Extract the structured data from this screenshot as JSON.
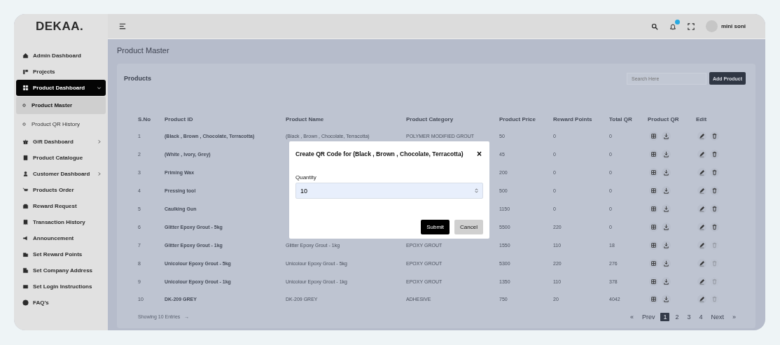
{
  "brand": "DEKAA.",
  "user": {
    "name": "mini soni"
  },
  "sidebar": {
    "items": [
      {
        "label": "Admin Dashboard",
        "kind": "item",
        "selected": false
      },
      {
        "label": "Projects",
        "kind": "item",
        "selected": false
      },
      {
        "label": "Product Dashboard",
        "kind": "group",
        "selected": true,
        "expanded": true,
        "children": [
          {
            "label": "Product Master",
            "selected": true
          },
          {
            "label": "Product QR History",
            "selected": false
          }
        ]
      },
      {
        "label": "Gift Dashboard",
        "kind": "group",
        "selected": false,
        "expanded": false
      },
      {
        "label": "Product Catalogue",
        "kind": "item",
        "selected": false
      },
      {
        "label": "Customer Dashboard",
        "kind": "group",
        "selected": false,
        "expanded": false
      },
      {
        "label": "Products Order",
        "kind": "item",
        "selected": false
      },
      {
        "label": "Reward Request",
        "kind": "item",
        "selected": false
      },
      {
        "label": "Transaction History",
        "kind": "item",
        "selected": false
      },
      {
        "label": "Announcement",
        "kind": "item",
        "selected": false
      },
      {
        "label": "Set Reward Points",
        "kind": "item",
        "selected": false
      },
      {
        "label": "Set Company Address",
        "kind": "item",
        "selected": false
      },
      {
        "label": "Set Login Instructions",
        "kind": "item",
        "selected": false
      },
      {
        "label": "FAQ's",
        "kind": "item",
        "selected": false
      }
    ]
  },
  "page_title": "Product Master",
  "card": {
    "title": "Products",
    "search": {
      "placeholder": "Search Here"
    },
    "add_button": "Add Product"
  },
  "table": {
    "columns": [
      "S.No",
      "Product ID",
      "Product Name",
      "Product Category",
      "Product Price",
      "Reward Points",
      "Total QR",
      "Product QR",
      "Edit"
    ],
    "rows": [
      {
        "sno": "1",
        "id": "(Black , Brown , Chocolate, Terracotta)",
        "name": "(Black , Brown , Chocolate, Terracotta)",
        "category": "POLYMER MODIFIED GROUT",
        "price": "50",
        "points": "0",
        "total": "0",
        "delete_disabled": false
      },
      {
        "sno": "2",
        "id": "(White , Ivory, Grey)",
        "name": null,
        "category": null,
        "price": "45",
        "points": "0",
        "total": "0",
        "delete_disabled": false
      },
      {
        "sno": "3",
        "id": "Priming Wax",
        "name": null,
        "category": null,
        "price": "200",
        "points": "0",
        "total": "0",
        "delete_disabled": false
      },
      {
        "sno": "4",
        "id": "Pressing tool",
        "name": null,
        "category": null,
        "price": "500",
        "points": "0",
        "total": "0",
        "delete_disabled": false
      },
      {
        "sno": "5",
        "id": "Caulking Gun",
        "name": null,
        "category": null,
        "price": "1150",
        "points": "0",
        "total": "0",
        "delete_disabled": false
      },
      {
        "sno": "6",
        "id": "Glitter Epoxy Grout - 5kg",
        "name": null,
        "category": null,
        "price": "5500",
        "points": "220",
        "total": "0",
        "delete_disabled": false
      },
      {
        "sno": "7",
        "id": "Glitter Epoxy Grout - 1kg",
        "name": "Glitter Epoxy Grout - 1kg",
        "category": "EPOXY GROUT",
        "price": "1550",
        "points": "110",
        "total": "18",
        "delete_disabled": true
      },
      {
        "sno": "8",
        "id": "Unicolour Epoxy Grout - 5kg",
        "name": "Unicolour Epoxy Grout - 5kg",
        "category": "EPOXY GROUT",
        "price": "5300",
        "points": "220",
        "total": "276",
        "delete_disabled": true
      },
      {
        "sno": "9",
        "id": "Unicolour Epoxy Grout - 1kg",
        "name": "Unicolour Epoxy Grout - 1kg",
        "category": "EPOXY GROUT",
        "price": "1350",
        "points": "110",
        "total": "378",
        "delete_disabled": true
      },
      {
        "sno": "10",
        "id": "DK-209 GREY",
        "name": "DK-209 GREY",
        "category": "ADHESIVE",
        "price": "750",
        "points": "20",
        "total": "4042",
        "delete_disabled": true
      }
    ]
  },
  "footer": {
    "showing": "Showing 10 Entries",
    "arrow": "→"
  },
  "pagination": {
    "first": "«",
    "prev": "Prev",
    "pages": [
      {
        "label": "1",
        "selected": true
      },
      {
        "label": "2",
        "selected": false
      },
      {
        "label": "3",
        "selected": false
      },
      {
        "label": "4",
        "selected": false
      }
    ],
    "next": "Next",
    "last": "»"
  },
  "modal": {
    "title": "Create QR Code for (Black , Brown , Chocolate, Terracotta)",
    "close": "×",
    "field_label": "Quantity",
    "value": "10",
    "buttons": [
      {
        "label": "Submit",
        "kind": "primary"
      },
      {
        "label": "Cancel",
        "kind": "secondary"
      }
    ]
  }
}
